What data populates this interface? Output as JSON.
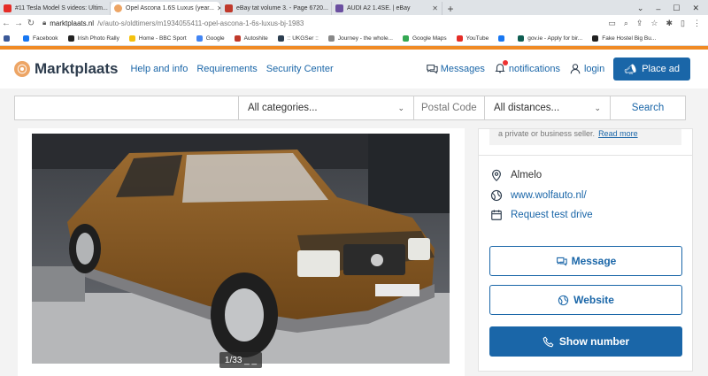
{
  "browser": {
    "tabs": [
      {
        "title": "#11 Tesla Model S videos: Ultim...",
        "icon": "youtube-icon",
        "color": "#e52d27"
      },
      {
        "title": "Opel Ascona 1.6S Luxus (year...",
        "icon": "marktplaats-icon",
        "color": "#eda565",
        "active": true
      },
      {
        "title": "eBay tat volume 3. - Page 6720...",
        "icon": "car-icon",
        "color": "#c0392b"
      },
      {
        "title": "AUDI A2 1.4SE. | eBay",
        "icon": "ebay-icon",
        "color": "#6b4fa0"
      }
    ],
    "url_host": "marktplaats.nl",
    "url_path": "/v/auto-s/oldtimers/m1934055411-opel-ascona-1-6s-luxus-bj-1983",
    "bookmarks": [
      {
        "label": "",
        "color": "#3b5998"
      },
      {
        "label": "Facebook",
        "color": "#1877f2"
      },
      {
        "label": "Irish Photo Rally",
        "color": "#222"
      },
      {
        "label": "Home - BBC Sport",
        "color": "#f4c20d"
      },
      {
        "label": "Google",
        "color": "#4285f4"
      },
      {
        "label": "Autoshite",
        "color": "#c0392b"
      },
      {
        "label": ":: UKGSer ::",
        "color": "#2c3e50"
      },
      {
        "label": "Journey - the whole...",
        "color": "#888"
      },
      {
        "label": "Google Maps",
        "color": "#34a853"
      },
      {
        "label": "YouTube",
        "color": "#e52d27"
      },
      {
        "label": "",
        "color": "#1877f2"
      },
      {
        "label": "gov.ie - Apply for bir...",
        "color": "#0f5e52"
      },
      {
        "label": "Fake Hostel Big Bu...",
        "color": "#222"
      }
    ]
  },
  "header": {
    "logo_text": "Marktplaats",
    "links": [
      "Help and info",
      "Requirements",
      "Security Center"
    ],
    "messages": "Messages",
    "notifications": "notifications",
    "login": "login",
    "place_ad": "Place ad"
  },
  "search": {
    "query": "",
    "category": "All categories...",
    "postal_placeholder": "Postal Code",
    "distance": "All distances...",
    "button": "Search"
  },
  "listing": {
    "photo_counter": "1/33 _ _"
  },
  "seller": {
    "strip_text": "a private or business seller.",
    "strip_link": "Read more",
    "location": "Almelo",
    "website": "www.wolfauto.nl/",
    "test_drive": "Request test drive",
    "message_button": "Message",
    "website_button": "Website",
    "phone_button": "Show number"
  },
  "colors": {
    "accent": "#1a66a8",
    "brand_orange": "#f08a24"
  }
}
